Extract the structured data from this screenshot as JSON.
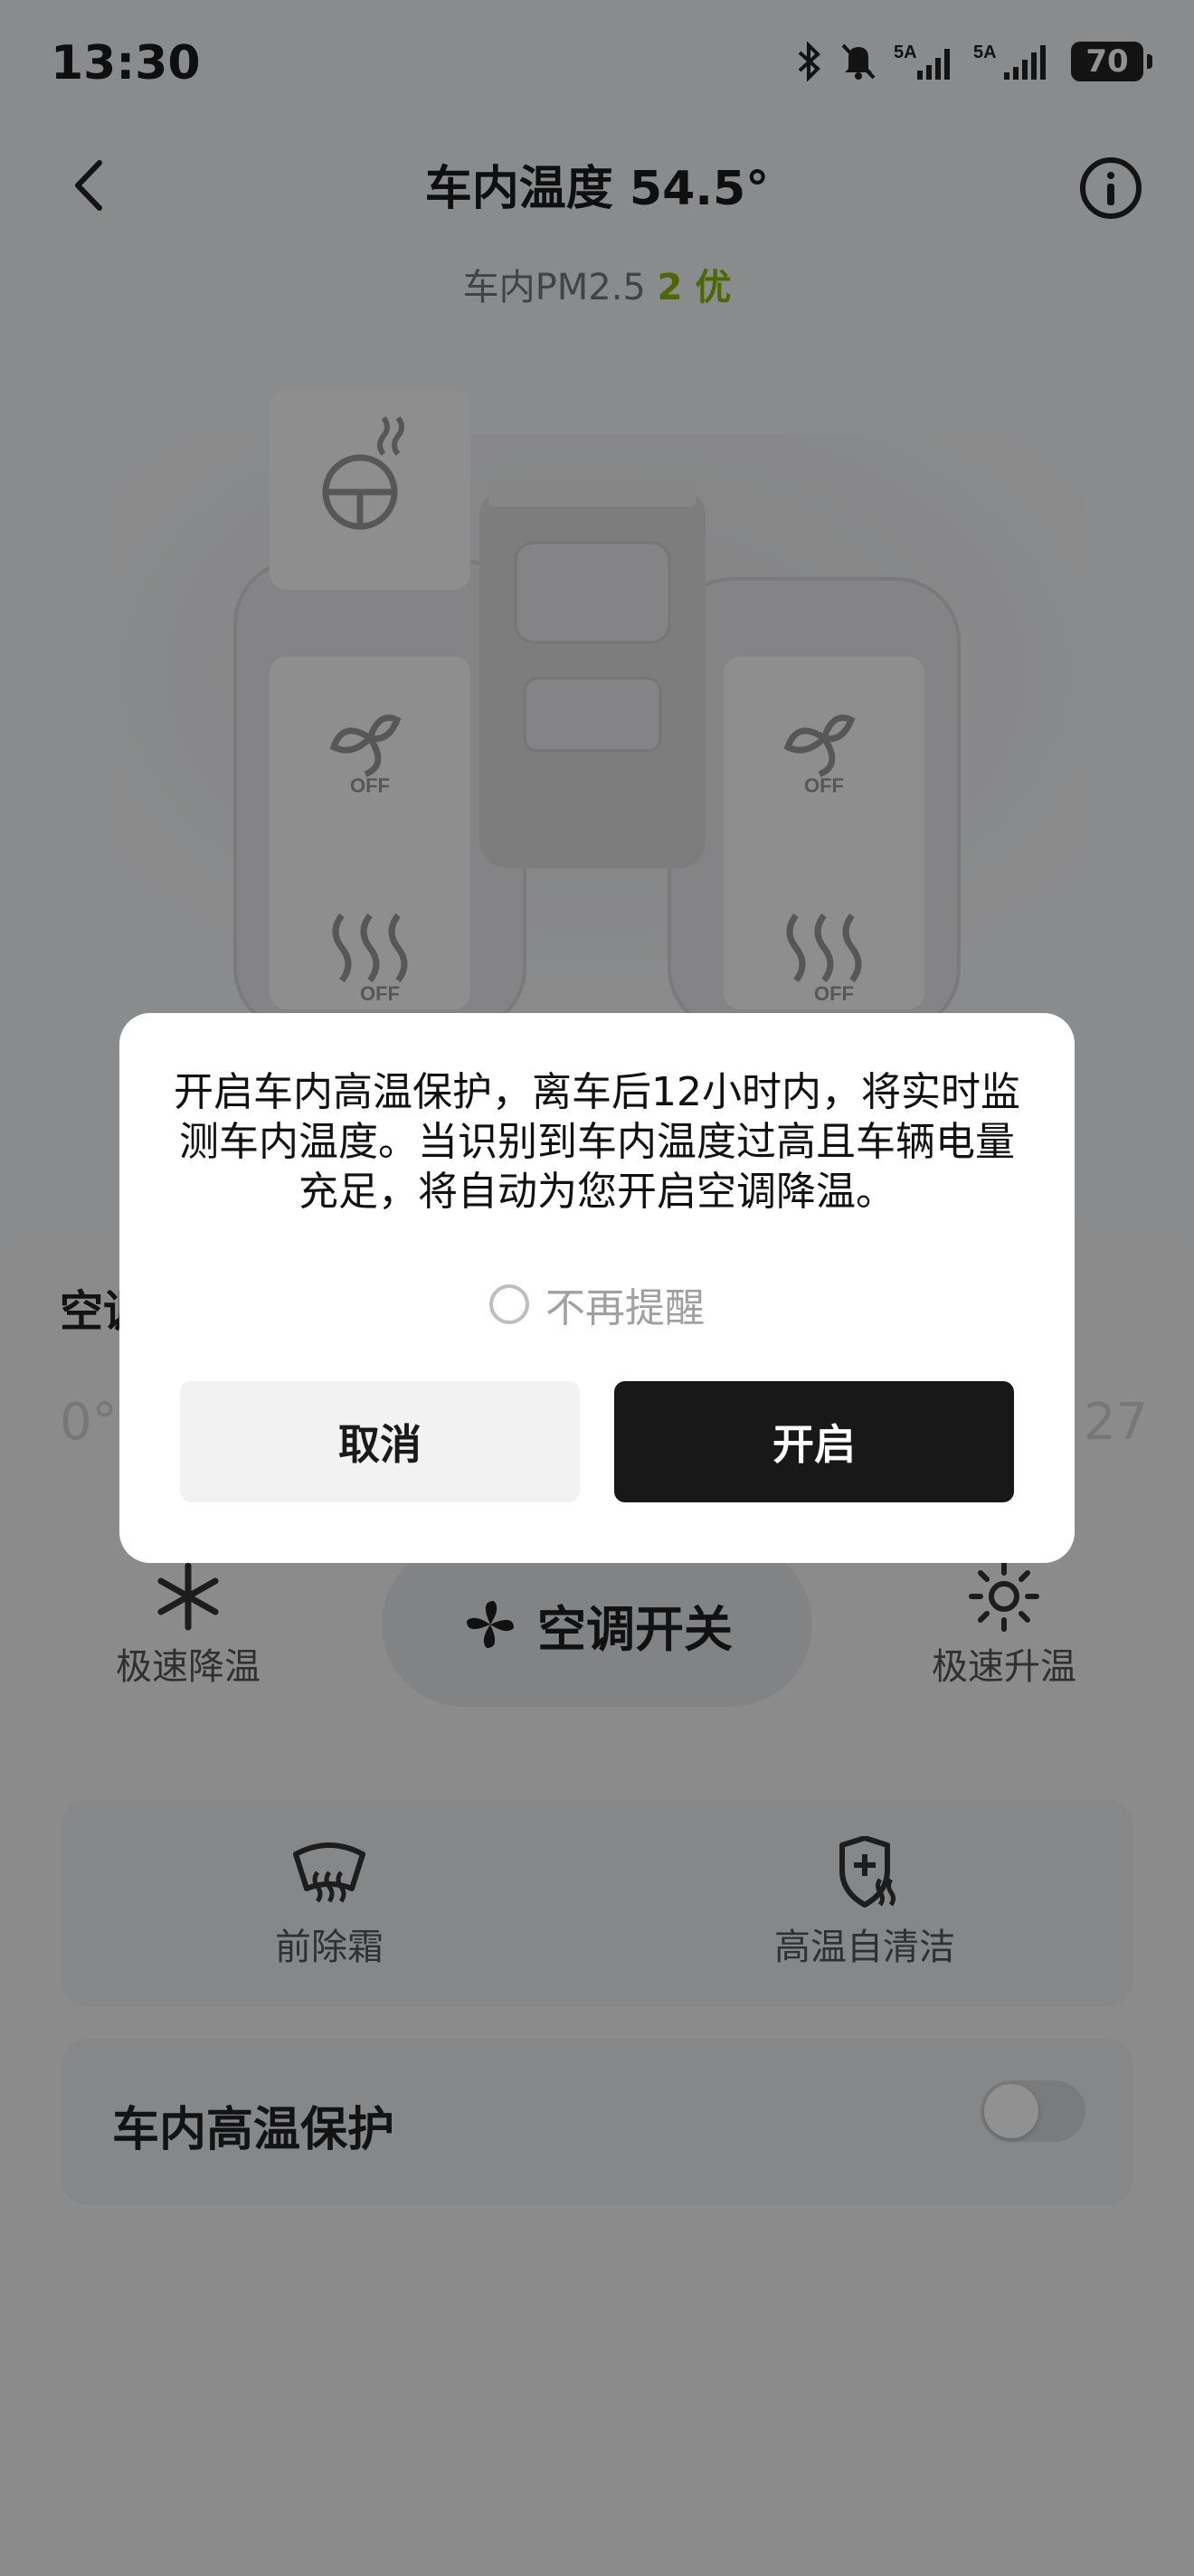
{
  "status_bar": {
    "time": "13:30",
    "battery": "70",
    "net1": "5A",
    "net2": "5A"
  },
  "header": {
    "title": "车内温度 54.5°"
  },
  "pm": {
    "label": "车内PM2.5",
    "value": "2 优"
  },
  "seats": {
    "off_label": "OFF"
  },
  "ac": {
    "title_partial": "空调",
    "temp_left": "0°",
    "temp_right": "27",
    "quick_cool": "极速降温",
    "quick_heat": "极速升温",
    "switch_label": "空调开关"
  },
  "functions": {
    "defrost": "前除霜",
    "self_clean": "高温自清洁"
  },
  "protection": {
    "label": "车内高温保护",
    "enabled": false
  },
  "dialog": {
    "message": "开启车内高温保护，离车后12小时内，将实时监测车内温度。当识别到车内温度过高且车辆电量充足，将自动为您开启空调降温。",
    "dont_remind": "不再提醒",
    "cancel": "取消",
    "confirm": "开启"
  },
  "colors": {
    "good": "#8ab800",
    "confirm_bg": "#181818"
  }
}
